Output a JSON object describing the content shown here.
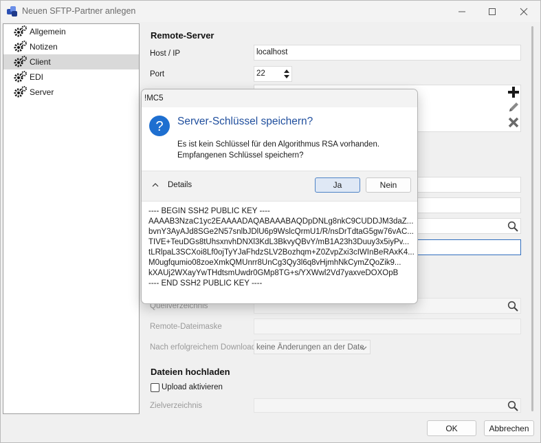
{
  "window": {
    "title": "Neuen SFTP-Partner anlegen",
    "minimize_icon": "minimize-icon",
    "maximize_icon": "maximize-icon",
    "close_icon": "close-icon"
  },
  "sidebar": {
    "items": [
      {
        "label": "Allgemein",
        "icon": "gear-icon"
      },
      {
        "label": "Notizen",
        "icon": "gear-icon"
      },
      {
        "label": "Client",
        "icon": "gear-icon",
        "selected": true
      },
      {
        "label": "EDI",
        "icon": "gear-icon"
      },
      {
        "label": "Server",
        "icon": "gear-icon"
      }
    ]
  },
  "main": {
    "remote_server": {
      "title": "Remote-Server",
      "host_label": "Host / IP",
      "host_value": "localhost",
      "port_label": "Port",
      "port_value": "22"
    },
    "download": {
      "source_dir_label": "Quellverzeichnis",
      "remote_mask_label": "Remote-Dateimaske",
      "after_download_label": "Nach erfolgreichem Download...",
      "after_download_value": "keine Änderungen an der Date"
    },
    "upload": {
      "title": "Dateien hochladen",
      "enable_label": "Upload aktivieren",
      "enable_checked": false,
      "target_dir_label": "Zielverzeichnis"
    }
  },
  "footer": {
    "ok_label": "OK",
    "cancel_label": "Abbrechen"
  },
  "dialog": {
    "title": "!MC5",
    "heading": "Server-Schlüssel speichern?",
    "message_line1": "Es ist kein Schlüssel für den Algorithmus RSA vorhanden.",
    "message_line2": "Empfangenen Schlüssel speichern?",
    "details_label": "Details",
    "yes_label": "Ja",
    "no_label": "Nein",
    "key_lines": [
      "---- BEGIN SSH2 PUBLIC KEY ----",
      "AAAAB3NzaC1yc2EAAAADAQABAAABAQDpDNLg8nkC9CUDDJM3daZ...",
      "bvnY3AyAJd8SGe2N57snlbJDlU6p9WslcQrmU1/R/nsDrTdtaG5gw76vAC...",
      "TIVE+TeuDGs8tUhsxnvhDNXl3KdL3BkvyQBvY/mB1A23h3Duuy3x5iyPv...",
      "tLRlpaL3SCXoi8Lf0ojTyYJaFhdzSLV2Bozhqm+Z0ZvpZxi3cIWInBeRAxK4...",
      "M0ugfqumio08zoeXmkQMUnrr8UnCg3Qy3l6q8vHjmhNkCymZQoZik9...",
      "kXAUj2WXayYwTHdtsmUwdr0GMp8TG+s/YXWwl2Vd7yaxveDOXOpB",
      "---- END SSH2 PUBLIC KEY ----"
    ]
  },
  "colors": {
    "accent": "#1f4e9d",
    "selection": "#d9d9d9",
    "focus_border": "#2f6dbd",
    "add_icon": "#1a1a1a"
  }
}
